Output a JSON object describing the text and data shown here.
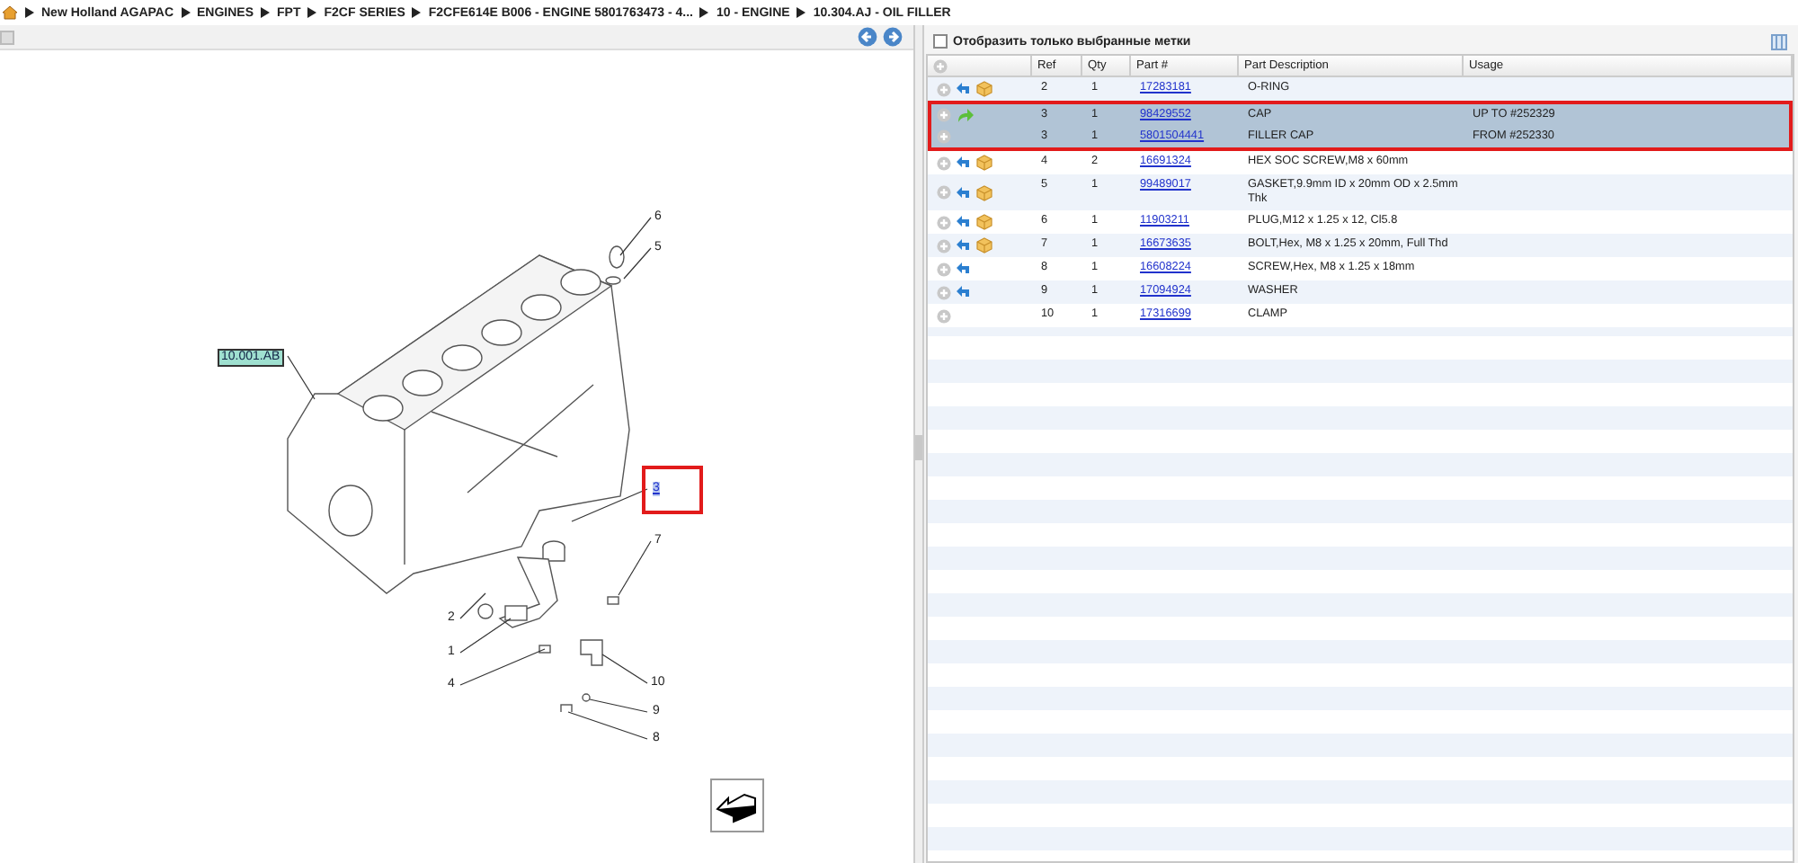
{
  "breadcrumb": [
    "New Holland AGAPAC",
    "ENGINES",
    "FPT",
    "F2CF SERIES",
    "F2CFE614E B006 - ENGINE 5801763473 - 4...",
    "10 - ENGINE",
    "10.304.AJ - OIL FILLER"
  ],
  "diagram": {
    "callouts": [
      {
        "label": "6",
        "kind": "number",
        "selected": false
      },
      {
        "label": "5",
        "kind": "number",
        "selected": false
      },
      {
        "label": "10.001.AB",
        "kind": "reference",
        "selected": false
      },
      {
        "label": "3",
        "kind": "number",
        "selected": true
      },
      {
        "label": "7",
        "kind": "number",
        "selected": false
      },
      {
        "label": "2",
        "kind": "number",
        "selected": false
      },
      {
        "label": "1",
        "kind": "number",
        "selected": false
      },
      {
        "label": "4",
        "kind": "number",
        "selected": false
      },
      {
        "label": "10",
        "kind": "number",
        "selected": false
      },
      {
        "label": "9",
        "kind": "number",
        "selected": false
      },
      {
        "label": "8",
        "kind": "number",
        "selected": false
      }
    ]
  },
  "filter": {
    "label": "Отобразить только выбранные метки",
    "checked": false
  },
  "table": {
    "columns": [
      "Ref",
      "Qty",
      "Part #",
      "Part Description",
      "Usage"
    ],
    "rows": [
      {
        "reuse": true,
        "replace": false,
        "box": true,
        "ref": "2",
        "qty": "1",
        "part": "17283181",
        "description": "O-RING",
        "selected": false
      },
      {
        "reuse": false,
        "replace": true,
        "box": false,
        "ref": "3",
        "qty": "1",
        "part": "98429552",
        "description": "CAP",
        "usage": "UP TO #252329",
        "selected": true
      },
      {
        "reuse": false,
        "replace": false,
        "box": false,
        "ref": "3",
        "qty": "1",
        "part": "5801504441",
        "description": "FILLER CAP",
        "usage": "FROM #252330",
        "selected": true
      },
      {
        "reuse": true,
        "replace": false,
        "box": true,
        "ref": "4",
        "qty": "2",
        "part": "16691324",
        "description": "HEX SOC SCREW,M8 x 60mm",
        "selected": false
      },
      {
        "reuse": true,
        "replace": false,
        "box": true,
        "ref": "5",
        "qty": "1",
        "part": "99489017",
        "description": "GASKET,9.9mm ID x 20mm OD x 2.5mm Thk",
        "selected": false
      },
      {
        "reuse": true,
        "replace": false,
        "box": true,
        "ref": "6",
        "qty": "1",
        "part": "11903211",
        "description": "PLUG,M12 x 1.25 x 12, Cl5.8",
        "selected": false
      },
      {
        "reuse": true,
        "replace": false,
        "box": true,
        "ref": "7",
        "qty": "1",
        "part": "16673635",
        "description": "BOLT,Hex, M8 x 1.25 x 20mm, Full Thd",
        "selected": false
      },
      {
        "reuse": true,
        "replace": false,
        "box": false,
        "ref": "8",
        "qty": "1",
        "part": "16608224",
        "description": "SCREW,Hex, M8 x 1.25 x 18mm",
        "selected": false
      },
      {
        "reuse": true,
        "replace": false,
        "box": false,
        "ref": "9",
        "qty": "1",
        "part": "17094924",
        "description": "WASHER",
        "selected": false
      },
      {
        "reuse": false,
        "replace": false,
        "box": false,
        "ref": "10",
        "qty": "1",
        "part": "17316699",
        "description": "CLAMP",
        "selected": false
      }
    ]
  }
}
